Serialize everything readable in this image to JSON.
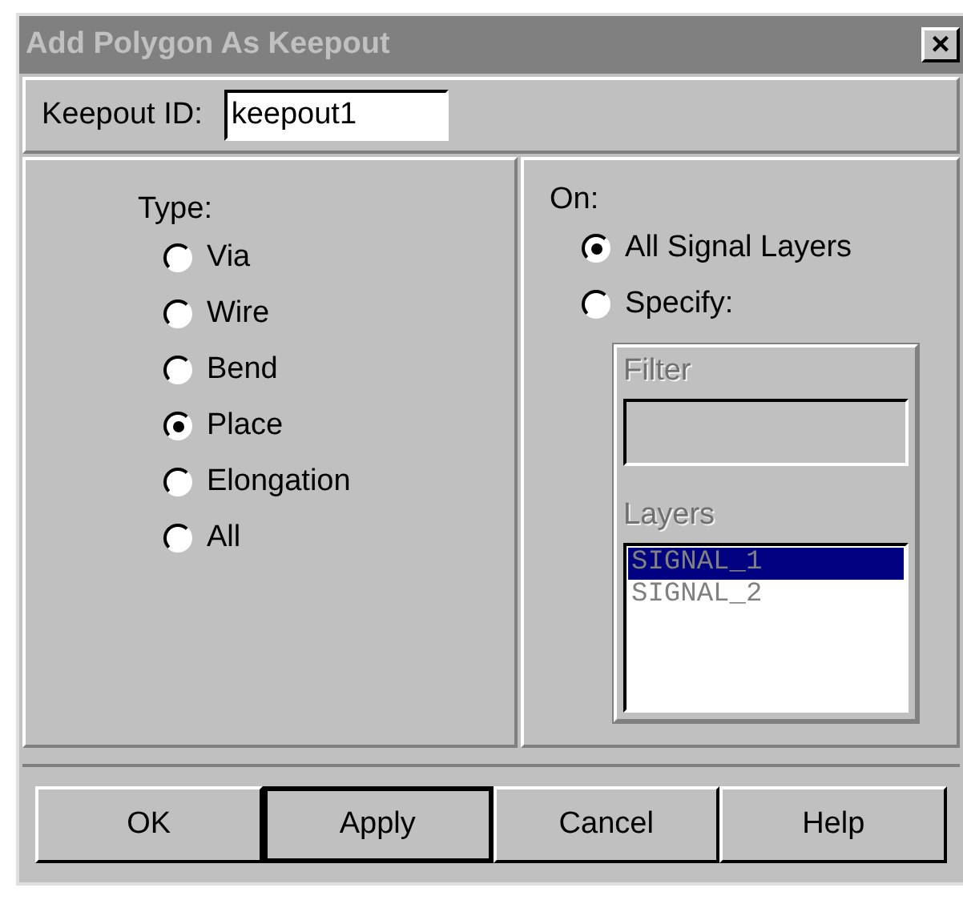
{
  "window": {
    "title": "Add Polygon As Keepout",
    "close": "×"
  },
  "keepout_id": {
    "label": "Keepout ID:",
    "value": "keepout1"
  },
  "type": {
    "label": "Type:",
    "options": [
      {
        "label": "Via",
        "selected": false
      },
      {
        "label": "Wire",
        "selected": false
      },
      {
        "label": "Bend",
        "selected": false
      },
      {
        "label": "Place",
        "selected": true
      },
      {
        "label": "Elongation",
        "selected": false
      },
      {
        "label": "All",
        "selected": false
      }
    ]
  },
  "on": {
    "label": "On:",
    "options": [
      {
        "label": "All Signal Layers",
        "selected": true
      },
      {
        "label": "Specify:",
        "selected": false
      }
    ],
    "filter": {
      "label": "Filter",
      "disabled": true
    },
    "layers": {
      "label": "Layers",
      "disabled": true,
      "items": [
        {
          "label": "SIGNAL_1",
          "selected": true
        },
        {
          "label": "SIGNAL_2",
          "selected": false
        }
      ]
    }
  },
  "buttons": [
    {
      "label": "OK",
      "default": false
    },
    {
      "label": "Apply",
      "default": true
    },
    {
      "label": "Cancel",
      "default": false
    },
    {
      "label": "Help",
      "default": false
    }
  ]
}
